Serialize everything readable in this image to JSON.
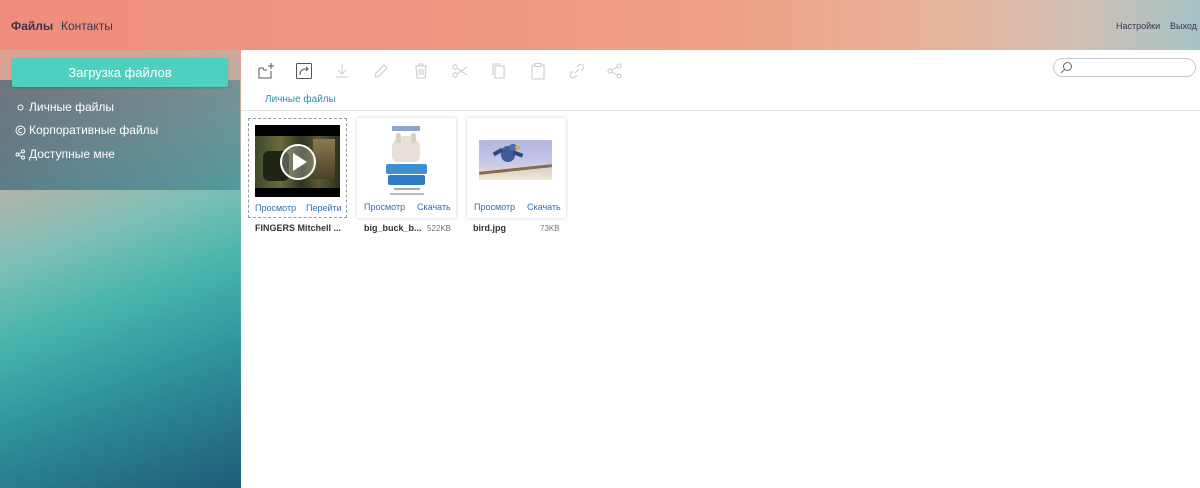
{
  "topnav": {
    "files": "Файлы",
    "contacts": "Контакты",
    "settings": "Настройки",
    "logout": "Выход"
  },
  "sidebar": {
    "upload_label": "Загрузка файлов",
    "items": [
      {
        "label": "Личные файлы",
        "icon": "circle-icon"
      },
      {
        "label": "Корпоративные файлы",
        "icon": "copyright-icon"
      },
      {
        "label": "Доступные мне",
        "icon": "share-icon"
      }
    ]
  },
  "toolbar": {
    "icons": [
      "new-folder-icon",
      "redo-icon",
      "download-icon",
      "edit-icon",
      "trash-icon",
      "cut-icon",
      "copy-icon",
      "paste-icon",
      "link-icon",
      "share-icon"
    ]
  },
  "search": {
    "placeholder": ""
  },
  "breadcrumb": "Личные файлы",
  "files": [
    {
      "name": "FINGERS Mitchell ...",
      "size": "",
      "action1": "Просмотр",
      "action2": "Перейти",
      "type": "video"
    },
    {
      "name": "big_buck_b...",
      "size": "522KB",
      "action1": "Просмотр",
      "action2": "Скачать",
      "type": "image"
    },
    {
      "name": "bird.jpg",
      "size": "73KB",
      "action1": "Просмотр",
      "action2": "Скачать",
      "type": "image"
    }
  ],
  "colors": {
    "accent": "#4fcfbf",
    "link": "#2f6fb3",
    "breadcrumb": "#2c8fb0"
  }
}
